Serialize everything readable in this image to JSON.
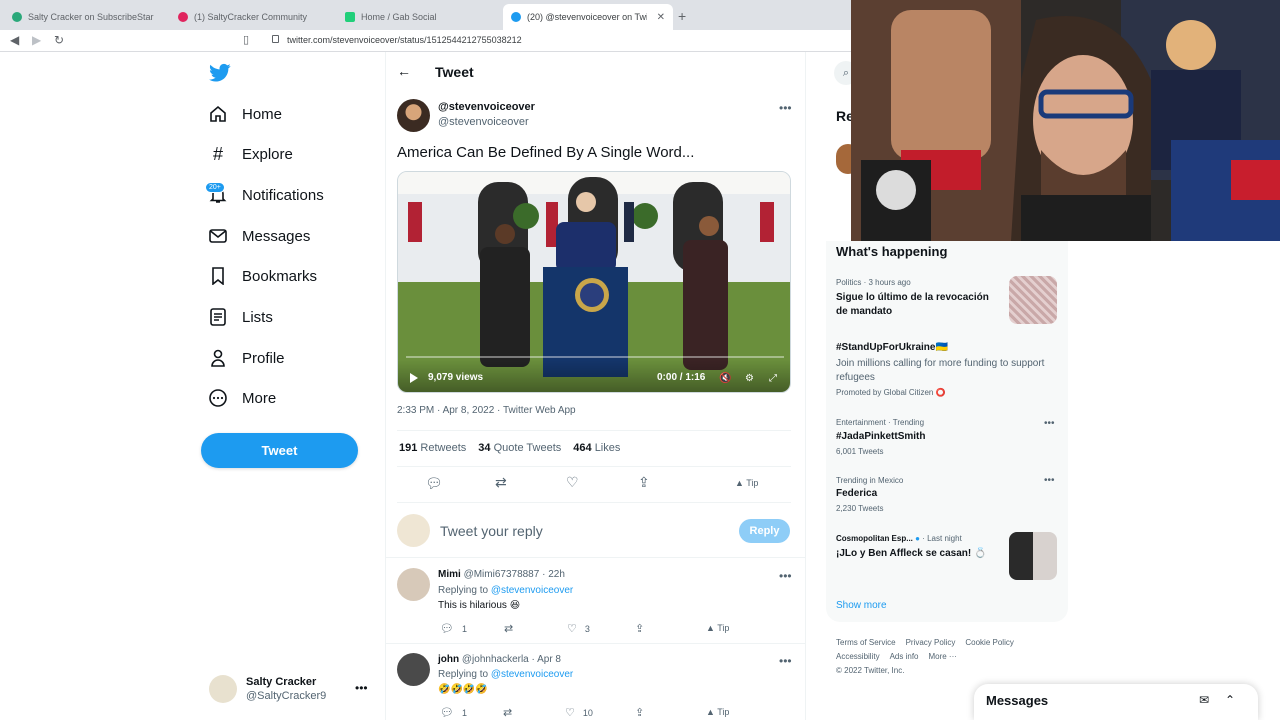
{
  "browser": {
    "tabs": [
      {
        "title": "Salty Cracker on SubscribeStar",
        "active": false
      },
      {
        "title": "(1) SaltyCracker Community",
        "active": false
      },
      {
        "title": "Home / Gab Social",
        "active": false
      },
      {
        "title": "(20) @stevenvoiceover on Twitter",
        "active": true
      }
    ],
    "url": "twitter.com/stevenvoiceover/status/1512544212755038212"
  },
  "nav": {
    "items": [
      {
        "label": "Home",
        "icon": "home-icon"
      },
      {
        "label": "Explore",
        "icon": "hashtag-icon"
      },
      {
        "label": "Notifications",
        "icon": "bell-icon"
      },
      {
        "label": "Messages",
        "icon": "envelope-icon"
      },
      {
        "label": "Bookmarks",
        "icon": "bookmark-icon"
      },
      {
        "label": "Lists",
        "icon": "list-icon"
      },
      {
        "label": "Profile",
        "icon": "person-icon"
      },
      {
        "label": "More",
        "icon": "more-circle-icon"
      }
    ],
    "notification_badge": "20+",
    "tweet_button": "Tweet",
    "account": {
      "name": "Salty Cracker",
      "handle": "@SaltyCracker9"
    }
  },
  "main": {
    "header": "Tweet",
    "author": {
      "name": "@stevenvoiceover",
      "handle": "@stevenvoiceover"
    },
    "text": "America Can Be Defined By A Single Word...",
    "video": {
      "views": "9,079 views",
      "time": "0:00 / 1:16"
    },
    "meta": "2:33 PM · Apr 8, 2022 · Twitter Web App",
    "stats": {
      "retweets": "191",
      "retweets_label": "Retweets",
      "quotes": "34",
      "quotes_label": "Quote Tweets",
      "likes": "464",
      "likes_label": "Likes"
    },
    "tip_label": "Tip",
    "reply_placeholder": "Tweet your reply",
    "reply_button": "Reply",
    "replies": [
      {
        "name": "Mimi",
        "handle": "@Mimi67378887",
        "time": "22h",
        "replying_prefix": "Replying to",
        "replying_to": "@stevenvoiceover",
        "text": "This is hilarious 😆",
        "reply_count": "1",
        "like_count": "3"
      },
      {
        "name": "john",
        "handle": "@johnhackerla",
        "time": "Apr 8",
        "replying_prefix": "Replying to",
        "replying_to": "@stevenvoiceover",
        "text": "🤣🤣🤣🤣",
        "reply_count": "1",
        "like_count": "10"
      }
    ]
  },
  "right": {
    "relevant_label": "Re",
    "whats_happening": "What's happening",
    "trends": [
      {
        "category": "Politics · 3 hours ago",
        "name": "Sigue lo último de la revocación de mandato"
      },
      {
        "name": "#StandUpForUkraine🇺🇦",
        "desc": "Join millions calling for more funding to support refugees",
        "promo": "Promoted by Global Citizen ⭕"
      },
      {
        "category": "Entertainment · Trending",
        "name": "#JadaPinkettSmith",
        "count": "6,001 Tweets"
      },
      {
        "category": "Trending in Mexico",
        "name": "Federica",
        "count": "2,230 Tweets"
      },
      {
        "source": "Cosmopolitan Esp...",
        "time": "· Last night",
        "name": "¡JLo y Ben Affleck se casan! 💍"
      }
    ],
    "show_more": "Show more",
    "footer_row1": [
      "Terms of Service",
      "Privacy Policy",
      "Cookie Policy"
    ],
    "footer_row2": [
      "Accessibility",
      "Ads info",
      "More ···"
    ],
    "copyright": "© 2022 Twitter, Inc.",
    "messages": "Messages"
  },
  "colors": {
    "accent": "#1d9bf0",
    "text": "#0f1419",
    "muted": "#536471"
  }
}
